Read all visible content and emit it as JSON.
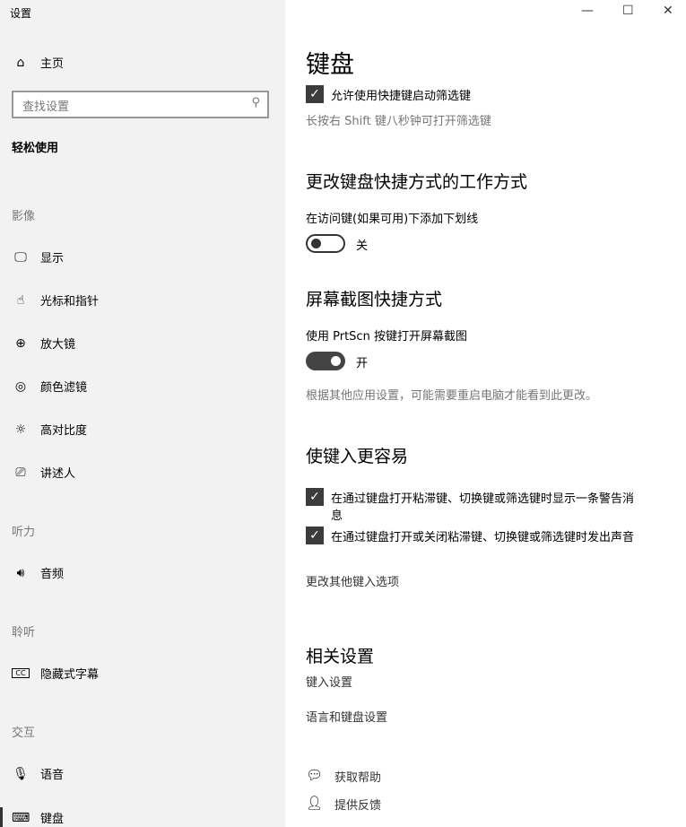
{
  "window": {
    "title": "设置",
    "minimize": "—",
    "maximize": "☐",
    "close": "✕"
  },
  "sidebar": {
    "home": "主页",
    "search_placeholder": "查找设置",
    "section": "轻松使用",
    "categories": {
      "vision": "影像",
      "hearing": "听力",
      "listening": "聆听",
      "interaction": "交互"
    },
    "items": [
      {
        "label": "显示",
        "icon": "monitor-icon"
      },
      {
        "label": "光标和指针",
        "icon": "cursor-icon"
      },
      {
        "label": "放大镜",
        "icon": "magnifier-icon"
      },
      {
        "label": "颜色滤镜",
        "icon": "palette-icon"
      },
      {
        "label": "高对比度",
        "icon": "brightness-icon"
      },
      {
        "label": "讲述人",
        "icon": "narrator-icon"
      },
      {
        "label": "音频",
        "icon": "speaker-icon"
      },
      {
        "label": "隐藏式字幕",
        "icon": "cc-icon"
      },
      {
        "label": "语音",
        "icon": "microphone-icon"
      },
      {
        "label": "键盘",
        "icon": "keyboard-icon",
        "selected": true
      }
    ]
  },
  "main": {
    "title": "键盘",
    "filter_shortcut": {
      "label": "允许使用快捷键启动筛选键",
      "checked": true,
      "hint": "长按右 Shift 键八秒钟可打开筛选键"
    },
    "shortcut_section": {
      "heading": "更改键盘快捷方式的工作方式",
      "label": "在访问键(如果可用)下添加下划线",
      "state": "关",
      "on": false
    },
    "print_section": {
      "heading": "屏幕截图快捷方式",
      "label": "使用 PrtScn 按键打开屏幕截图",
      "state": "开",
      "on": true,
      "note": "根据其他应用设置，可能需要重启电脑才能看到此更改。"
    },
    "typing_section": {
      "heading": "使键入更容易",
      "check1": "在通过键盘打开粘滞键、切换键或筛选键时显示一条警告消",
      "check1_wrap": "息",
      "check2": "在通过键盘打开或关闭粘滞键、切换键或筛选键时发出声音",
      "more": "更改其他键入选项"
    },
    "related": {
      "heading": "相关设置",
      "link1": "键入设置",
      "link2": "语言和键盘设置"
    },
    "help": {
      "get_help": "获取帮助",
      "feedback": "提供反馈"
    }
  }
}
